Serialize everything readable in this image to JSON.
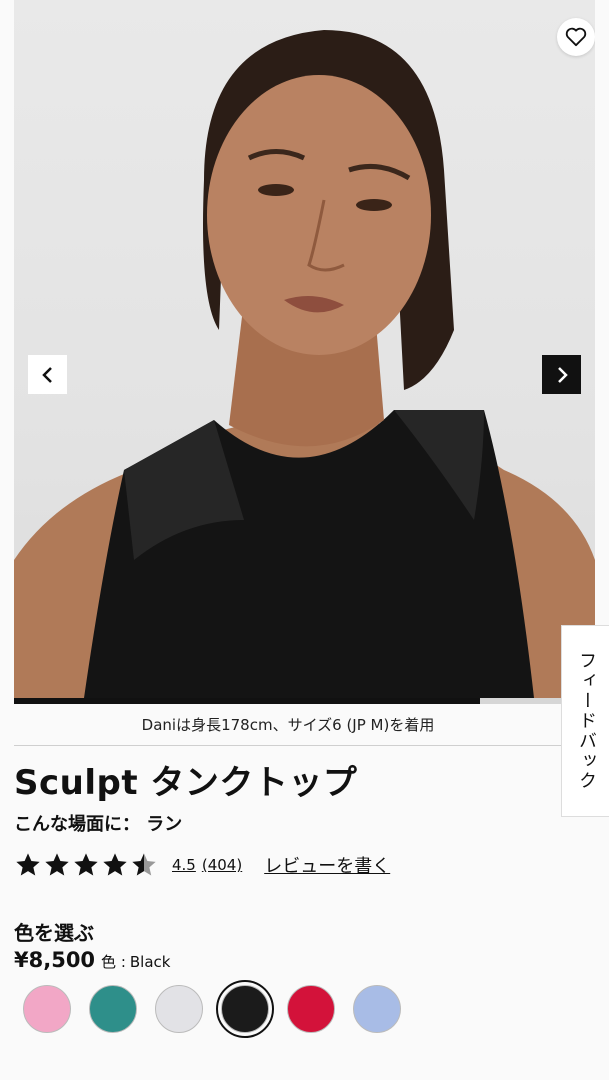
{
  "product": {
    "model_caption": "Daniは身長178cm、サイズ6 (JP M)を着用",
    "title": "Sculpt タンクトップ",
    "activity": "こんな場面に： ラン",
    "rating_value": "4.5",
    "review_count": "(404)",
    "write_review": "レビューを書く",
    "rating_stars": 4.5,
    "gallery_progress": 0.85
  },
  "feedback_tab": "フィードバック",
  "color_section": {
    "label": "色を選ぶ",
    "price": "¥8,500",
    "color_prefix": "色 :",
    "selected_color": "Black",
    "swatches": [
      {
        "color": "#f2a7c6",
        "selected": false
      },
      {
        "color": "#2e8f8a",
        "selected": false
      },
      {
        "color": "#e2e2e6",
        "selected": false
      },
      {
        "color": "#1b1b1b",
        "selected": true
      },
      {
        "color": "#d3123a",
        "selected": false
      },
      {
        "color": "#a8bce6",
        "selected": false
      }
    ]
  },
  "icons": {
    "wishlist": "heart-icon",
    "prev": "chevron-left-icon",
    "next": "chevron-right-icon",
    "star": "star-icon"
  }
}
